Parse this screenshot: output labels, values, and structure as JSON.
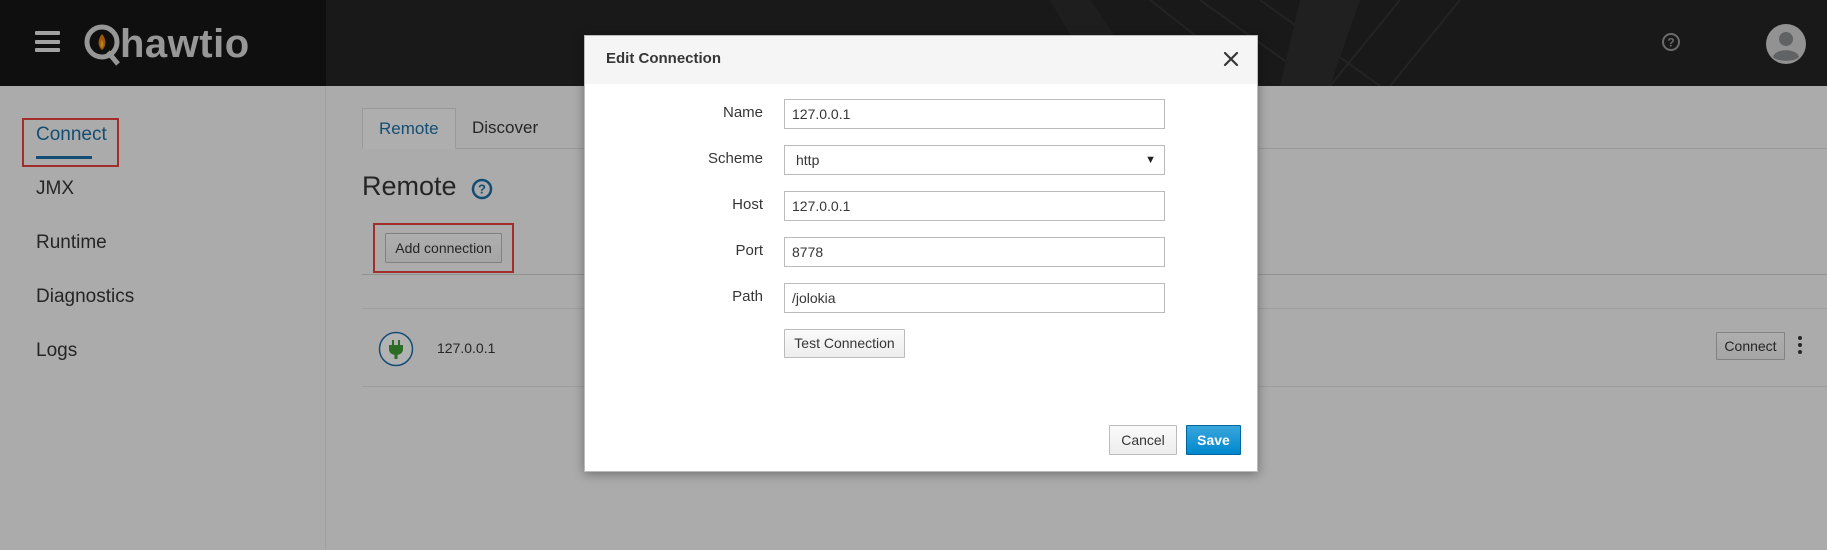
{
  "header": {
    "brand": "hawtio",
    "menu_icon": "hamburger-menu-icon",
    "help_icon": "help-circle-icon",
    "user_icon": "user-avatar-icon"
  },
  "sidebar": {
    "items": [
      {
        "label": "Connect",
        "active": true
      },
      {
        "label": "JMX"
      },
      {
        "label": "Runtime"
      },
      {
        "label": "Diagnostics"
      },
      {
        "label": "Logs"
      }
    ]
  },
  "main": {
    "tabs": [
      {
        "label": "Remote",
        "active": true
      },
      {
        "label": "Discover"
      }
    ],
    "title": "Remote",
    "add_connection_label": "Add connection",
    "connections": [
      {
        "name": "127.0.0.1",
        "connect_label": "Connect",
        "icon": "plug-icon"
      }
    ]
  },
  "modal": {
    "title": "Edit Connection",
    "fields": {
      "name": {
        "label": "Name",
        "value": "127.0.0.1"
      },
      "scheme": {
        "label": "Scheme",
        "value": "http"
      },
      "host": {
        "label": "Host",
        "value": "127.0.0.1"
      },
      "port": {
        "label": "Port",
        "value": "8778"
      },
      "path": {
        "label": "Path",
        "value": "/jolokia"
      }
    },
    "test_label": "Test Connection",
    "cancel_label": "Cancel",
    "save_label": "Save"
  },
  "colors": {
    "accent": "#1d6fa5",
    "primary_button": "#0088ce",
    "highlight_box": "#e8423e",
    "plug_green": "#3f9c35"
  }
}
